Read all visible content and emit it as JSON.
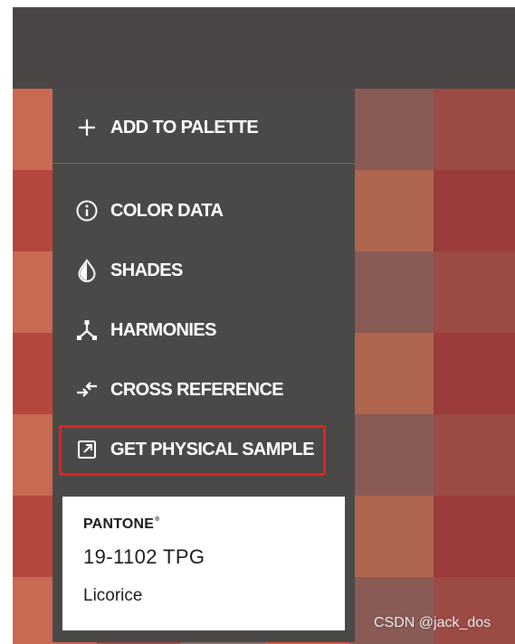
{
  "menu": {
    "add_to_palette": "ADD TO PALETTE",
    "color_data": "COLOR DATA",
    "shades": "SHADES",
    "harmonies": "HARMONIES",
    "cross_reference": "CROSS REFERENCE",
    "get_physical_sample": "GET PHYSICAL SAMPLE"
  },
  "swatch_card": {
    "brand": "PANTONE",
    "brand_mark": "®",
    "code": "19-1102 TPG",
    "name": "Licorice"
  },
  "watermark": "CSDN @jack_dos",
  "icons": {
    "add": "plus-icon",
    "color_data": "info-circle-icon",
    "shades": "drop-icon",
    "harmonies": "harmonies-icon",
    "cross_reference": "swap-arrows-icon",
    "get_physical_sample": "external-link-icon"
  },
  "colors": {
    "menu_bg": "#4b4948",
    "highlight": "#e0231f",
    "menu_text": "#ffffff"
  }
}
